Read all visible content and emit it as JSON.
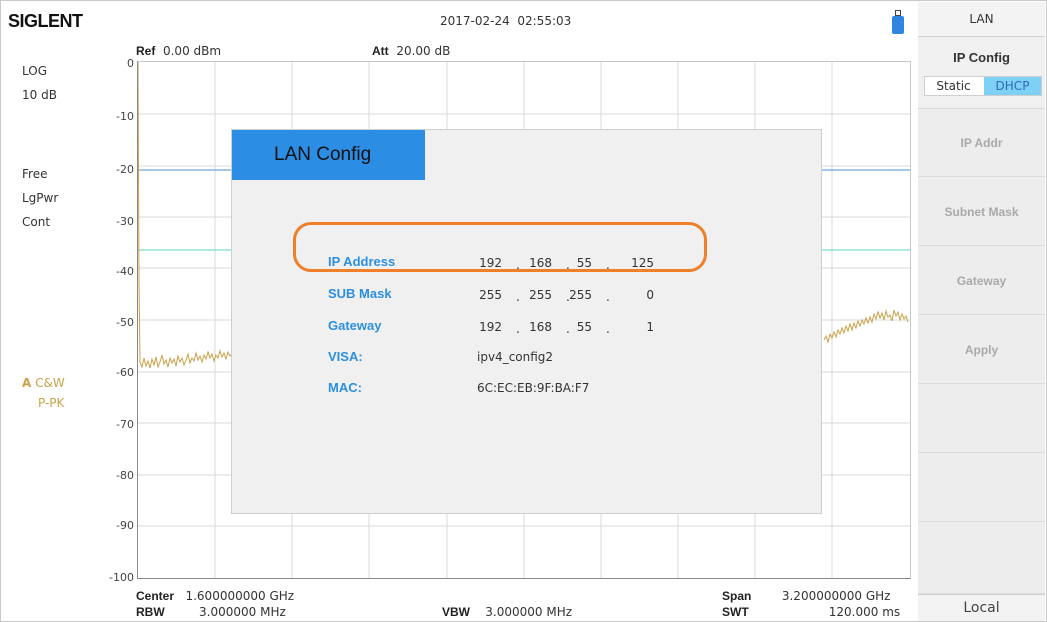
{
  "header": {
    "logo": "SIGLENT",
    "datetime": "2017-02-24  02:55:03"
  },
  "params": {
    "ref_label": "Ref",
    "ref_value": "0.00 dBm",
    "att_label": "Att",
    "att_value": "20.00 dB"
  },
  "left_info": {
    "scale_type": "LOG",
    "scale_div": "10 dB",
    "trig": "Free",
    "detector": "LgPwr",
    "sweep": "Cont",
    "trace_letter": "A",
    "trace_mode": "C&W",
    "trace_det": "P-PK"
  },
  "y_ticks": [
    "0",
    "-10",
    "-20",
    "-30",
    "-40",
    "-50",
    "-60",
    "-70",
    "-80",
    "-90",
    "-100"
  ],
  "bottom": {
    "center_label": "Center",
    "center_value": "1.600000000 GHz",
    "rbw_label": "RBW",
    "rbw_value": "3.000000 MHz",
    "vbw_label": "VBW",
    "vbw_value": "3.000000 MHz",
    "span_label": "Span",
    "span_value": "3.200000000 GHz",
    "swt_label": "SWT",
    "swt_value": "120.000 ms"
  },
  "menu": {
    "title": "LAN",
    "ip_config": "IP Config",
    "static": "Static",
    "dhcp": "DHCP",
    "buttons": [
      "IP Addr",
      "Subnet Mask",
      "Gateway",
      "Apply",
      "",
      "",
      "",
      ""
    ],
    "local": "Local"
  },
  "dialog": {
    "title": "LAN Config",
    "ip_label": "IP Address",
    "ip": [
      "192",
      "168",
      "55",
      "125"
    ],
    "mask_label": "SUB Mask",
    "mask": [
      "255",
      "255",
      "255",
      "0"
    ],
    "gw_label": "Gateway",
    "gw": [
      "192",
      "168",
      "55",
      "1"
    ],
    "visa_label": "VISA:",
    "visa": "ipv4_config2",
    "mac_label": "MAC:",
    "mac": "6C:EC:EB:9F:BA:F7"
  },
  "colors": {
    "accent": "#2b8de3",
    "highlight": "#f07f2a",
    "trace": "#c9a24a",
    "display_line": "#4a90d9",
    "threshold_line": "#5fd6c4"
  }
}
